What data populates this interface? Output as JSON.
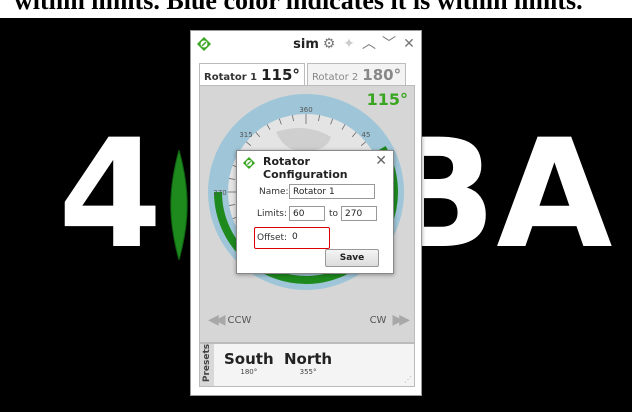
{
  "caption": {
    "text": "within limits. Blue color indicates it is within limits."
  },
  "background": {
    "left_text": "4",
    "right_text": "BA"
  },
  "window": {
    "title": "sim",
    "title_buttons": [
      "gear-icon",
      "pin-icon",
      "chevron-up-icon",
      "chevron-down-icon",
      "close-icon"
    ]
  },
  "tabs": [
    {
      "name": "Rotator 1",
      "degrees": "115°",
      "active": true
    },
    {
      "name": "Rotator 2",
      "degrees": "180°",
      "active": false
    }
  ],
  "dial": {
    "heading_readout": "115°",
    "tick_labels": [
      "360",
      "45",
      "270",
      "315"
    ],
    "range_start_deg": 60,
    "range_end_deg": 270,
    "heading_deg": 115,
    "colors": {
      "ring": "#9fc6d8",
      "arc": "#1e8a1e",
      "readout": "#3aa520"
    }
  },
  "controls": {
    "ccw_label": "CCW",
    "cw_label": "CW"
  },
  "presets": {
    "label": "Presets",
    "items": [
      {
        "name": "South",
        "degrees": "180°"
      },
      {
        "name": "North",
        "degrees": "355°"
      }
    ]
  },
  "dialog": {
    "title": "Rotator Configuration",
    "name_label": "Name:",
    "name_value": "Rotator 1",
    "limits_label": "Limits:",
    "limit_low": "60",
    "limits_to": "to",
    "limit_high": "270",
    "offset_label": "Offset:",
    "offset_value": "0",
    "save_label": "Save",
    "highlight_color": "#dd0000"
  }
}
